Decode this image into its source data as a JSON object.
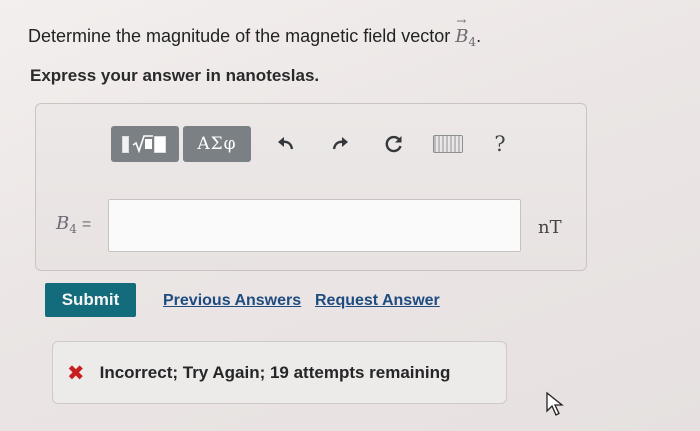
{
  "question": {
    "prefix": "Determine the magnitude of the magnetic field vector ",
    "vector_symbol": "B",
    "vector_subscript": "4",
    "vector_arrow": "→",
    "suffix": "."
  },
  "instruction": "Express your answer in nanoteslas.",
  "toolbar": {
    "templates_icon": "templates-icon",
    "symbols_label": "ΑΣφ",
    "undo_icon": "↶",
    "redo_icon": "↷",
    "reset_icon": "↻",
    "keyboard_icon": "keyboard-icon",
    "help_label": "?"
  },
  "answer": {
    "variable": "B",
    "variable_subscript": "4",
    "equals": "=",
    "value": "",
    "unit": "nT"
  },
  "actions": {
    "submit_label": "Submit",
    "previous_answers_label": "Previous Answers",
    "request_answer_label": "Request Answer"
  },
  "feedback": {
    "icon": "✖",
    "text": "Incorrect; Try Again; 19 attempts remaining"
  },
  "colors": {
    "submit_bg": "#136c7b",
    "link": "#1f4c80",
    "error": "#c71f1f"
  }
}
